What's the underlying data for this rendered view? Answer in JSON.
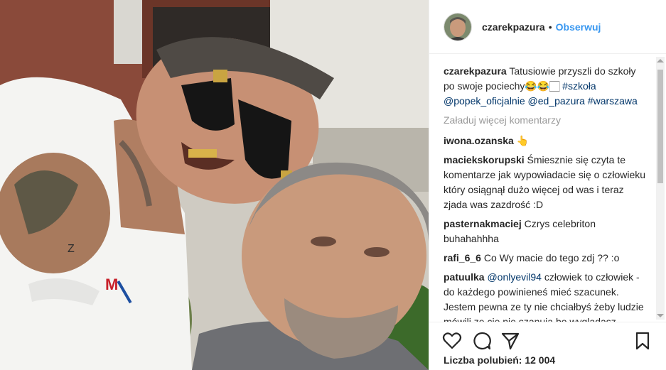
{
  "post": {
    "username": "czarekpazura",
    "separator": "•",
    "follow_label": "Obserwuj"
  },
  "caption": {
    "username": "czarekpazura",
    "text": "Tatusiowie przyszli do szkoły po swoje pociechy😂😂🏻 ",
    "tag_school": "#szkoła",
    "mention_1": "@popek_oficjalnie",
    "mention_2": "@ed_pazura",
    "tag_city": "#warszawa"
  },
  "load_more_label": "Załaduj więcej komentarzy",
  "comments": [
    {
      "username": "iwona.ozanska",
      "text": "👆"
    },
    {
      "username": "maciekskorupski",
      "text": "Śmiesznie się czyta te komentarze jak wypowiadacie się o człowieku który osiągnął dużo więcej od was i teraz zjada was zazdrość :D"
    },
    {
      "username": "pasternakmaciej",
      "text": "Czrys celebriton buhahahhha"
    },
    {
      "username": "rafi_6_6",
      "text": "Co Wy macie do tego zdj ?? :o"
    },
    {
      "username": "patuulka",
      "mention": "@onlyevil94",
      "text": " człowiek to człowiek - do każdego powinieneś mieć szacunek. Jestem pewna ze ty nie chciałbyś żeby ludzie mówili ze cię nie szanują bo wyglądasz „inaczej”. Najważniejsze jest to ze popek sam siebie akceptuje, ma"
    }
  ],
  "likes_label": "Liczba polubień: 12 004",
  "icons": [
    "heart-icon",
    "comment-icon",
    "share-icon",
    "bookmark-icon"
  ]
}
